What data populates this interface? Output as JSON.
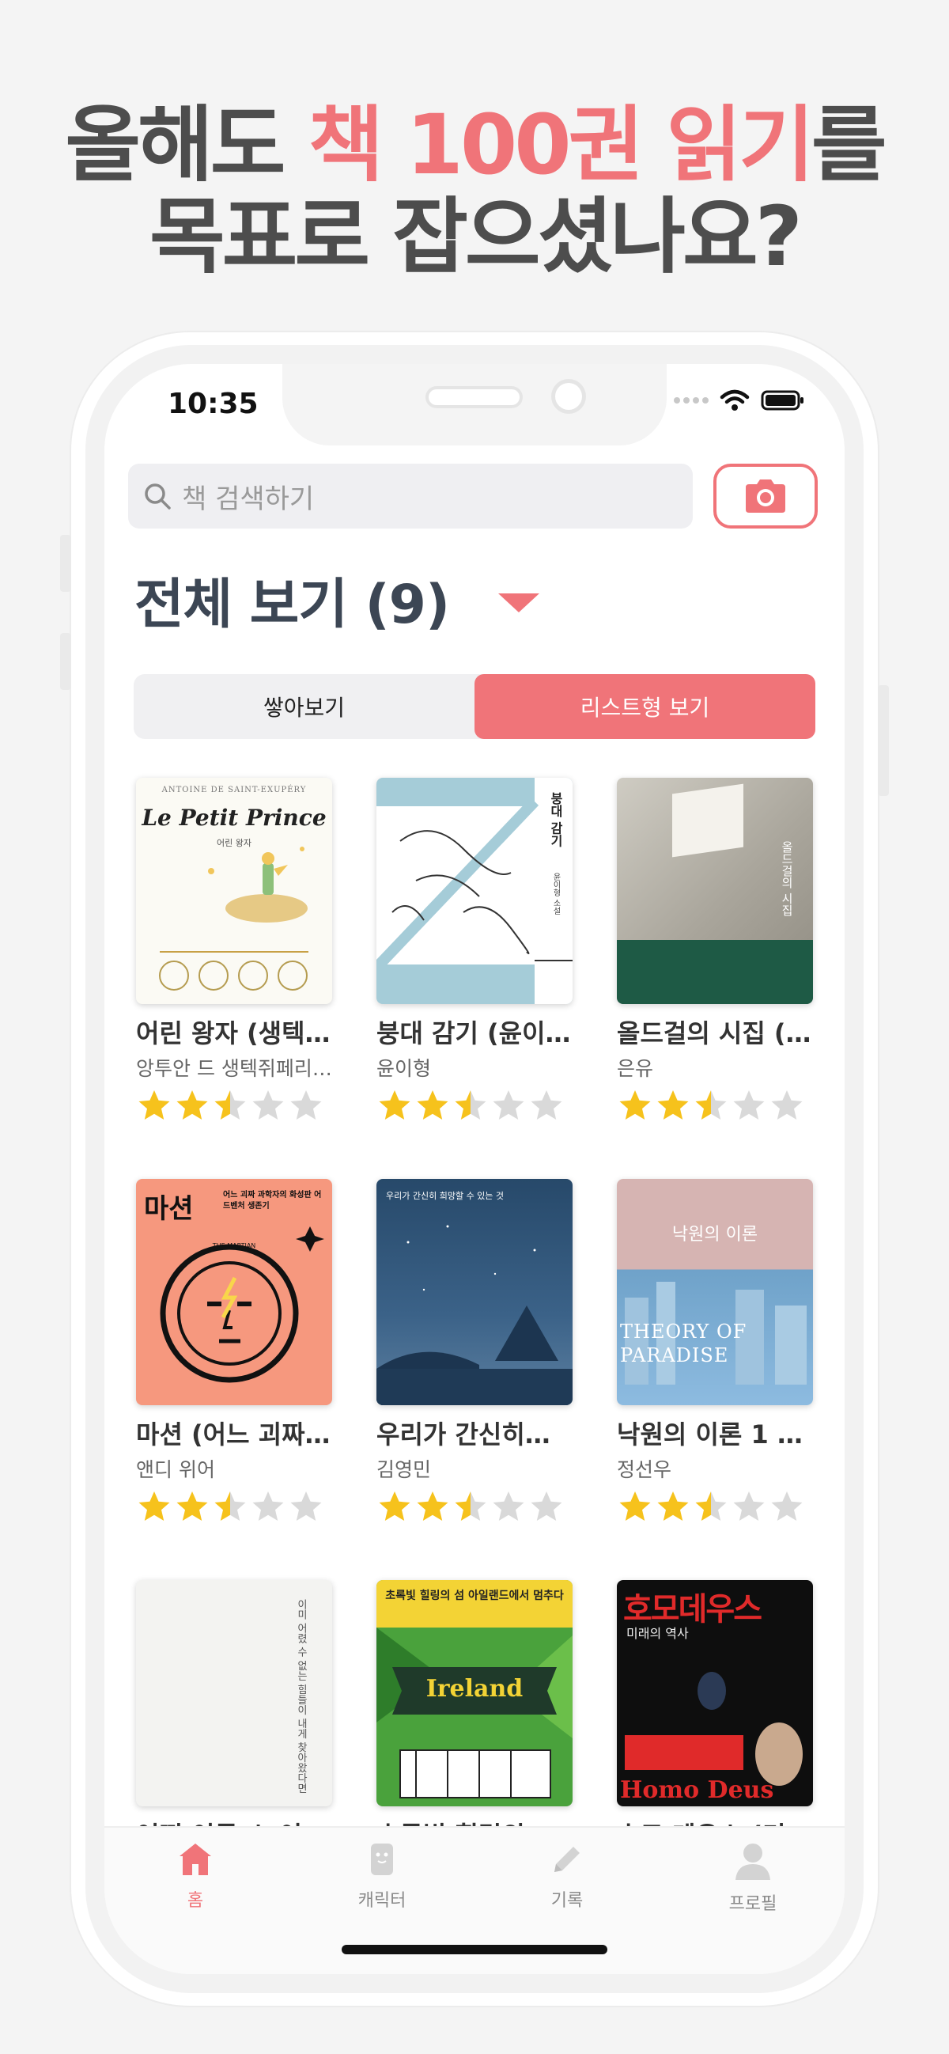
{
  "headline": {
    "line1_pre": "올해도 ",
    "line1_accent": "책 100권 읽기",
    "line1_post": "를",
    "line2": "목표로 잡으셨나요?"
  },
  "status": {
    "time": "10:35"
  },
  "search": {
    "placeholder": "책 검색하기"
  },
  "section": {
    "title": "전체 보기 (9)"
  },
  "view_toggle": {
    "stack_label": "쌓아보기",
    "list_label": "리스트형 보기",
    "active": "list"
  },
  "books": [
    {
      "title": "어린 왕자 (생텍…",
      "author": "앙투안 드 생텍쥐페리…",
      "rating": 2.5,
      "cover": {
        "top": "ANTOINE DE SAINT-EXUPÉRY",
        "main": "Le Petit Prince",
        "sub": "어린 왕자"
      }
    },
    {
      "title": "붕대 감기 (윤이…",
      "author": "윤이형",
      "rating": 2.5,
      "cover": {
        "main": "붕대 감기",
        "sub": "윤이형 소설"
      }
    },
    {
      "title": "올드걸의 시집 (…",
      "author": "은유",
      "rating": 2.5,
      "cover": {
        "main": "올드걸의 시집"
      }
    },
    {
      "title": "마션 (어느 괴짜…",
      "author": "앤디 위어",
      "rating": 2.5,
      "cover": {
        "main": "마션",
        "sub": "어느 괴짜 과학자의 화성판 어드벤처 생존기",
        "tag": "THE MARTIAN"
      }
    },
    {
      "title": "우리가 간신히…",
      "author": "김영민",
      "rating": 2.5,
      "cover": {
        "main": "우리가 간신히 희망할 수 있는 것"
      }
    },
    {
      "title": "낙원의 이론 1 (…",
      "author": "정선우",
      "rating": 2.5,
      "cover": {
        "main": "낙원의 이론",
        "en": "THEORY OF PARADISE"
      }
    },
    {
      "title": "어떤 이름 스 이…",
      "author": "",
      "rating": 0,
      "cover": {
        "main": "이미 어렸 수 없는 힘들이 내게 찾아왔다면"
      }
    },
    {
      "title": "초록빛 힐링의…",
      "author": "",
      "rating": 0,
      "cover": {
        "main": "초록빛 힐링의 섬 아일랜드에서 멈추다",
        "en": "Ireland"
      }
    },
    {
      "title": "호모 데우스 (미…",
      "author": "",
      "rating": 0,
      "cover": {
        "main": "호모데우스",
        "sub": "미래의 역사",
        "en": "Homo Deus"
      }
    }
  ],
  "tabbar": [
    {
      "label": "홈",
      "icon": "home-icon",
      "active": true
    },
    {
      "label": "캐릭터",
      "icon": "character-icon",
      "active": false
    },
    {
      "label": "기록",
      "icon": "pencil-icon",
      "active": false
    },
    {
      "label": "프로필",
      "icon": "profile-icon",
      "active": false
    }
  ],
  "colors": {
    "accent": "#f07479",
    "star": "#f6c21c",
    "star_empty": "#d9d9d9",
    "title": "#3c4654"
  }
}
